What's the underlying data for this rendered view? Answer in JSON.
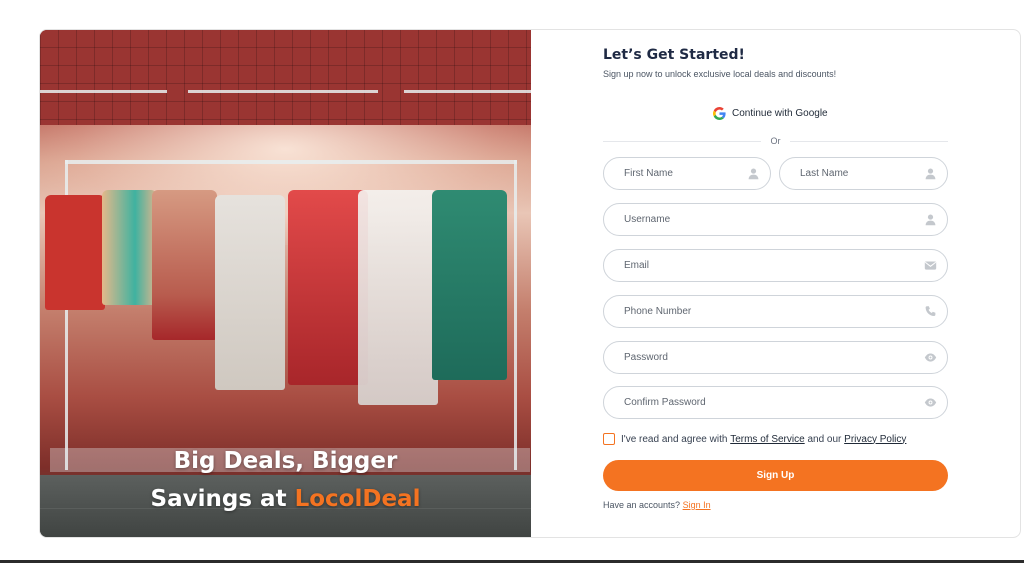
{
  "hero": {
    "headline_line1": "Big Deals, Bigger",
    "headline_line2_prefix": "Savings at ",
    "brand_name": "LocolDeal"
  },
  "form": {
    "title": "Let’s Get Started!",
    "subtitle": "Sign up now to unlock exclusive local deals and discounts!",
    "google_label": "Continue with Google",
    "divider_text": "Or",
    "fields": {
      "first_name": {
        "placeholder": "First Name",
        "icon": "user-icon"
      },
      "last_name": {
        "placeholder": "Last Name",
        "icon": "user-icon"
      },
      "username": {
        "placeholder": "Username",
        "icon": "user-icon"
      },
      "email": {
        "placeholder": "Email",
        "icon": "envelope-icon"
      },
      "phone": {
        "placeholder": "Phone Number",
        "icon": "phone-icon"
      },
      "password": {
        "placeholder": "Password",
        "icon": "eye-icon"
      },
      "confirm_password": {
        "placeholder": "Confirm Password",
        "icon": "eye-icon"
      }
    },
    "agree": {
      "prefix": "I've read and agree with ",
      "terms": "Terms of Service",
      "middle": " and our ",
      "privacy": "Privacy Policy",
      "checked": false
    },
    "signup_label": "Sign Up",
    "have_account": "Have an accounts? ",
    "signin_label": "Sign In"
  },
  "colors": {
    "accent": "#f47321",
    "title": "#1f2a44",
    "border": "#cfd4da"
  }
}
